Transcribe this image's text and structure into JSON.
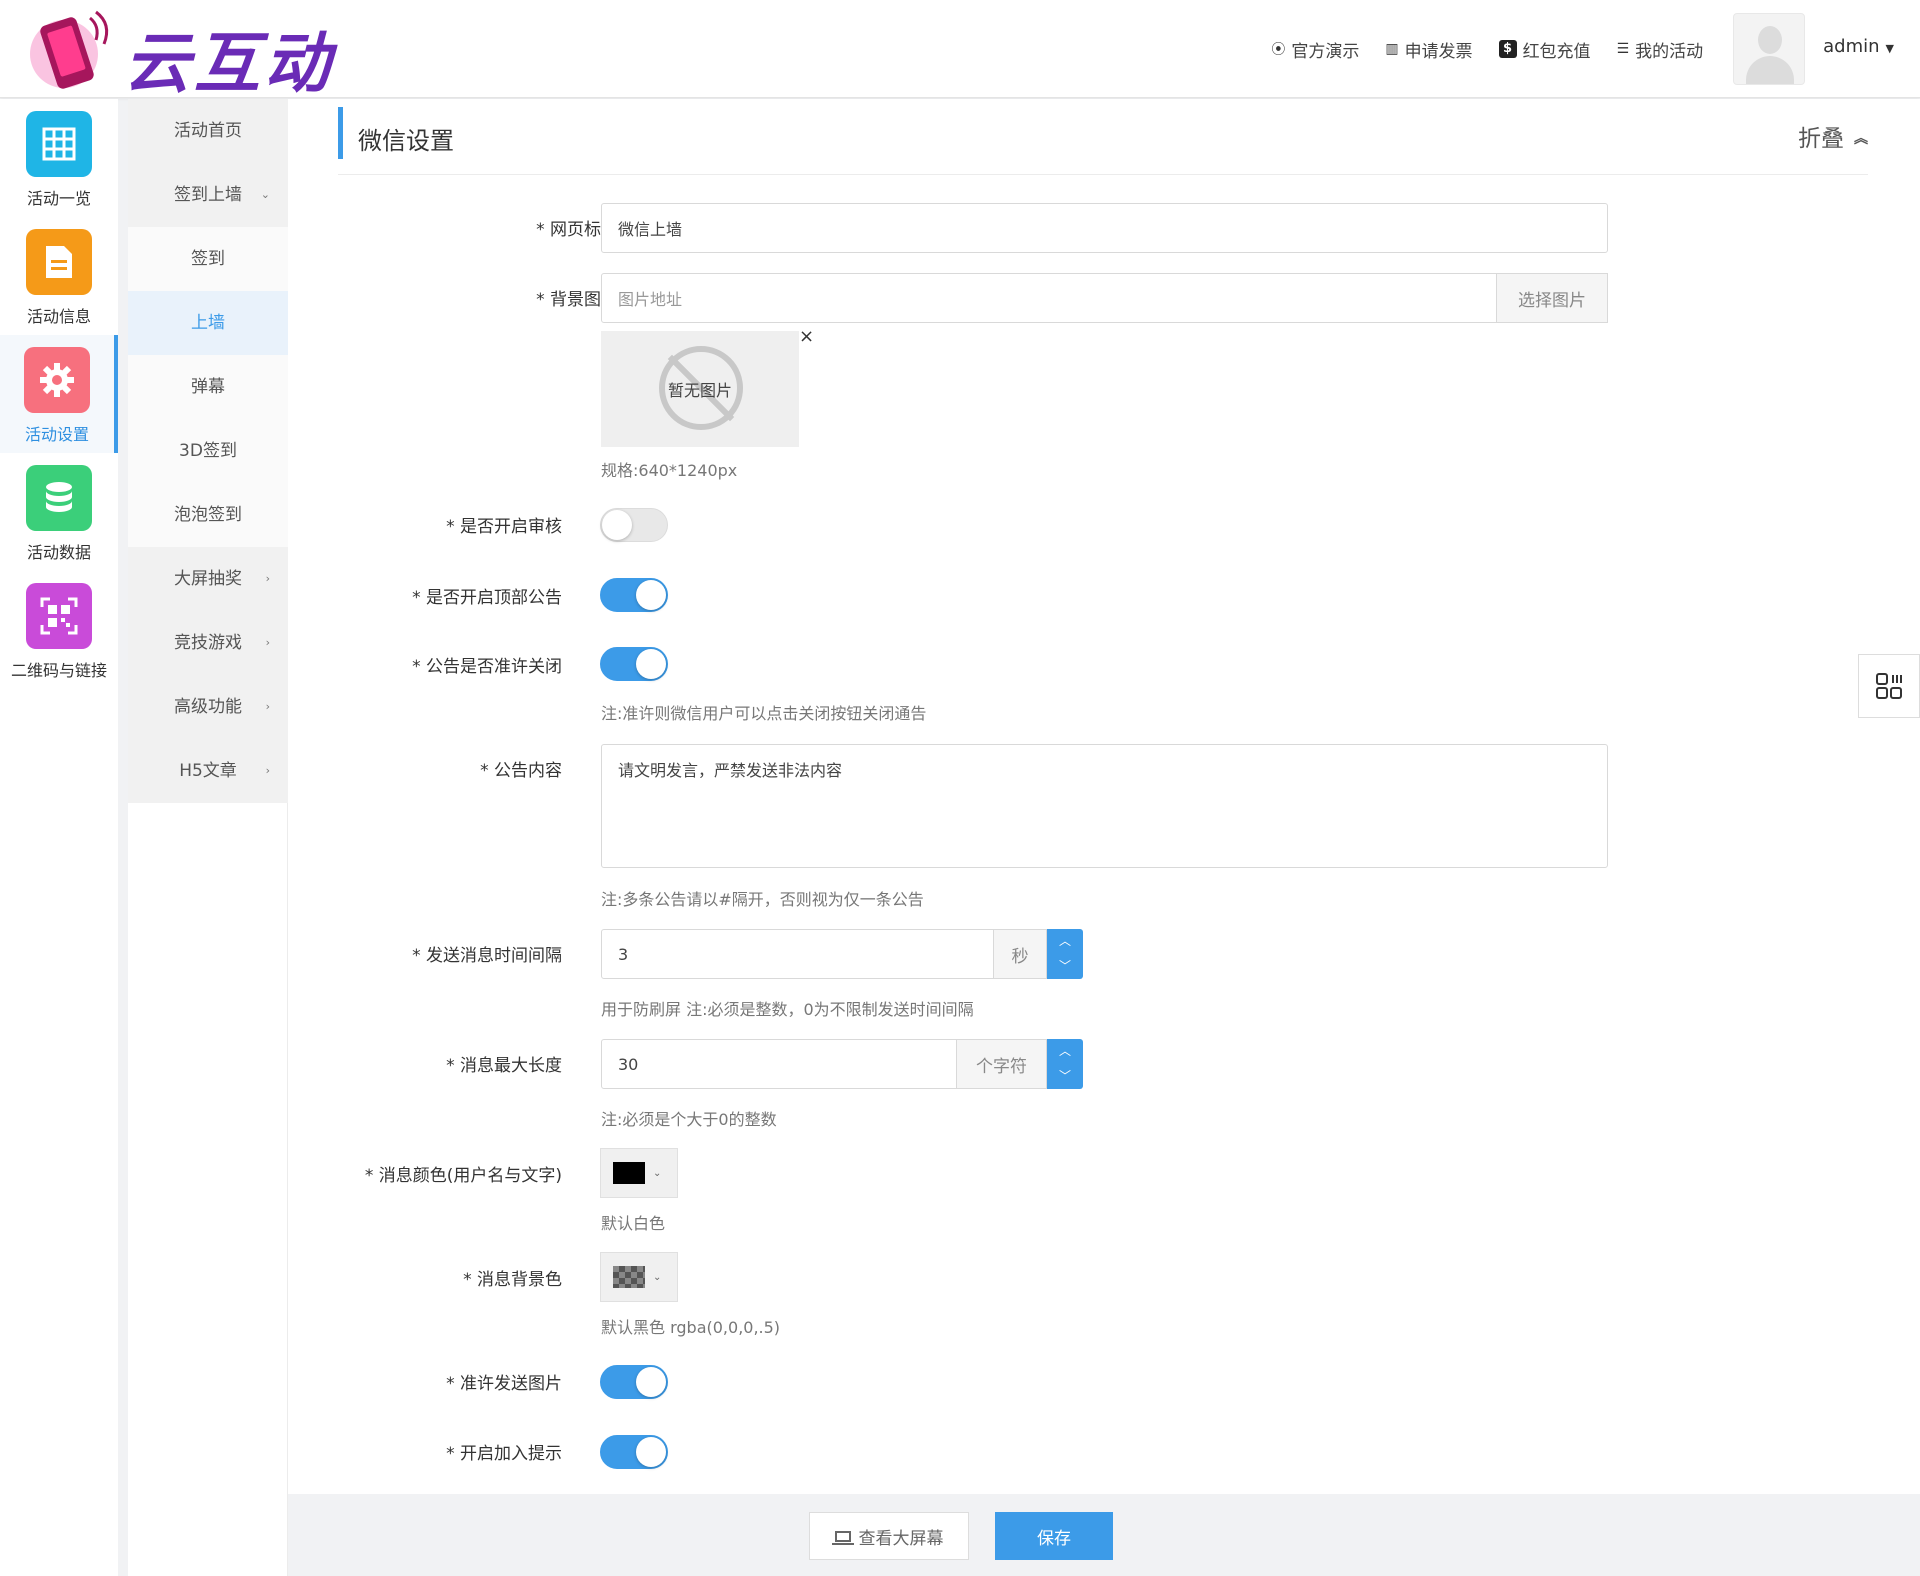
{
  "brand": {
    "name": "云互动"
  },
  "topnav": [
    {
      "icon": "play-circle-icon",
      "label": "官方演示"
    },
    {
      "icon": "barcode-icon",
      "label": "申请发票"
    },
    {
      "icon": "dollar-icon",
      "label": "红包充值"
    },
    {
      "icon": "list-icon",
      "label": "我的活动"
    }
  ],
  "user": {
    "name": "admin"
  },
  "iconbar": [
    {
      "label": "活动一览",
      "icon": "grid-icon",
      "color": "#1fb5e6"
    },
    {
      "label": "活动信息",
      "icon": "document-icon",
      "color": "#f59a18"
    },
    {
      "label": "活动设置",
      "icon": "gear-icon",
      "color": "#f7707e",
      "active": true
    },
    {
      "label": "活动数据",
      "icon": "database-icon",
      "color": "#3bcf7a"
    },
    {
      "label": "二维码与链接",
      "icon": "qrcode-icon",
      "color": "#c94bd9"
    }
  ],
  "submenu": [
    {
      "label": "活动首页"
    },
    {
      "label": "签到上墙"
    },
    {
      "label": "签到"
    },
    {
      "label": "上墙",
      "active": true
    },
    {
      "label": "弹幕"
    },
    {
      "label": "3D签到"
    },
    {
      "label": "泡泡签到"
    },
    {
      "label": "大屏抽奖"
    },
    {
      "label": "竞技游戏"
    },
    {
      "label": "高级功能"
    },
    {
      "label": "H5文章"
    }
  ],
  "panel": {
    "title": "微信设置",
    "fold_label": "折叠"
  },
  "form": {
    "page_title_label": "* 网页标题",
    "page_title_value": "微信上墙",
    "bg_image_label": "* 背景图片",
    "bg_image_placeholder": "图片地址",
    "choose_image": "选择图片",
    "no_image": "暂无图片",
    "remove_image": "×",
    "image_spec": "规格:640*1240px",
    "review_label": "* 是否开启审核",
    "review_on": false,
    "top_notice_label": "* 是否开启顶部公告",
    "top_notice_on": true,
    "notice_close_label": "* 公告是否准许关闭",
    "notice_close_on": true,
    "notice_close_note": "注:准许则微信用户可以点击关闭按钮关闭通告",
    "notice_content_label": "* 公告内容",
    "notice_content_value": "请文明发言，严禁发送非法内容",
    "notice_content_note": "注:多条公告请以#隔开，否则视为仅一条公告",
    "interval_label": "* 发送消息时间间隔",
    "interval_value": "3",
    "interval_unit": "秒",
    "interval_note": "用于防刷屏 注:必须是整数，0为不限制发送时间间隔",
    "maxlen_label": "* 消息最大长度",
    "maxlen_value": "30",
    "maxlen_unit": "个字符",
    "maxlen_note": "注:必须是个大于0的整数",
    "msg_color_label": "* 消息颜色(用户名与文字)",
    "msg_color": "#000000",
    "msg_color_note": "默认白色",
    "msg_bg_label": "* 消息背景色",
    "msg_bg_note": "默认黑色 rgba(0,0,0,.5)",
    "allow_image_label": "* 准许发送图片",
    "allow_image_on": true,
    "join_tip_label": "* 开启加入提示",
    "join_tip_on": true
  },
  "footer": {
    "view_screen": "查看大屏幕",
    "save": "保存"
  },
  "colors": {
    "accent": "#3c9be8"
  }
}
